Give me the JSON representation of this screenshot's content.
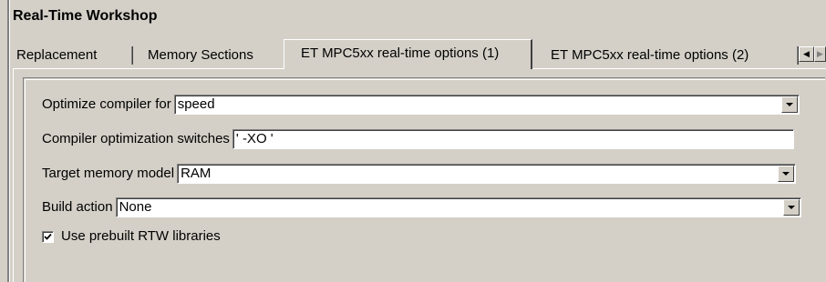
{
  "window": {
    "title": "Real-Time Workshop"
  },
  "tabs": [
    {
      "label": "Replacement",
      "active": false
    },
    {
      "label": "Memory Sections",
      "active": false
    },
    {
      "label": "ET MPC5xx real-time options (1)",
      "active": true
    },
    {
      "label": "ET MPC5xx real-time options (2)",
      "active": false
    }
  ],
  "tab_scroll": {
    "left_icon": "scroll-left-icon",
    "right_icon": "scroll-right-icon"
  },
  "options": {
    "optimize_compiler": {
      "label": "Optimize compiler for",
      "value": "speed"
    },
    "compiler_switches": {
      "label": "Compiler optimization switches",
      "value": "' -XO '"
    },
    "target_memory": {
      "label": "Target memory model",
      "value": "RAM"
    },
    "build_action": {
      "label": "Build action",
      "value": "None"
    },
    "use_prebuilt": {
      "label": "Use prebuilt RTW libraries",
      "checked": true
    }
  },
  "colors": {
    "face": "#d4d0c8",
    "shadow": "#808080",
    "highlight": "#ffffff",
    "dark_shadow": "#404040"
  }
}
